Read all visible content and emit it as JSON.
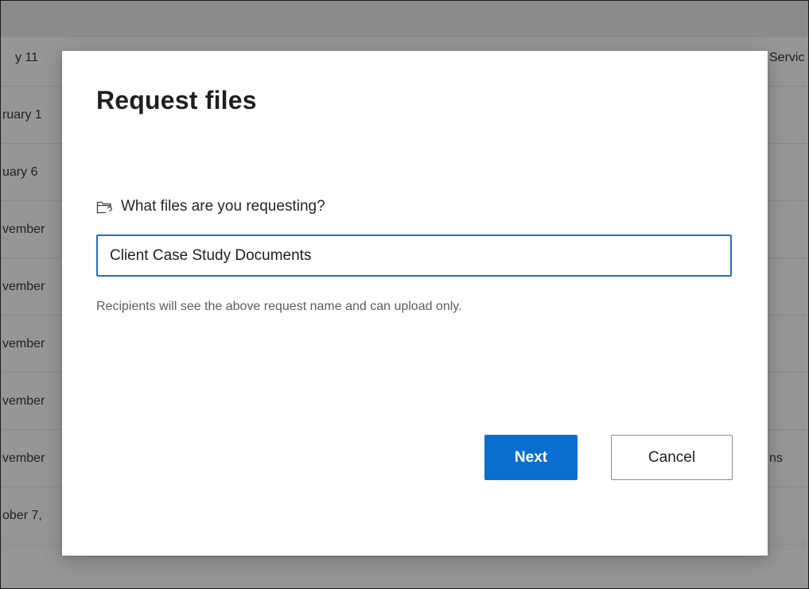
{
  "background": {
    "rows": [
      {
        "date": "y 11",
        "extra": "Servic"
      },
      {
        "date": "ruary 1",
        "extra": ""
      },
      {
        "date": "uary 6",
        "extra": ""
      },
      {
        "date": "vember",
        "extra": ""
      },
      {
        "date": "vember",
        "extra": ""
      },
      {
        "date": "vember",
        "extra": ""
      },
      {
        "date": "vember",
        "extra": ""
      },
      {
        "date": "vember",
        "extra": "ns"
      },
      {
        "date": "ober 7,",
        "extra": ""
      }
    ]
  },
  "dialog": {
    "title": "Request files",
    "field": {
      "icon": "folder-request-icon",
      "label": "What files are you requesting?",
      "value": "Client Case Study Documents",
      "placeholder": ""
    },
    "helper_text": "Recipients will see the above request name and can upload only.",
    "buttons": {
      "next_label": "Next",
      "cancel_label": "Cancel"
    }
  },
  "colors": {
    "accent": "#0a6ed1",
    "input_focus_border": "#1a73c8",
    "overlay": "rgba(0,0,0,0.40)"
  }
}
